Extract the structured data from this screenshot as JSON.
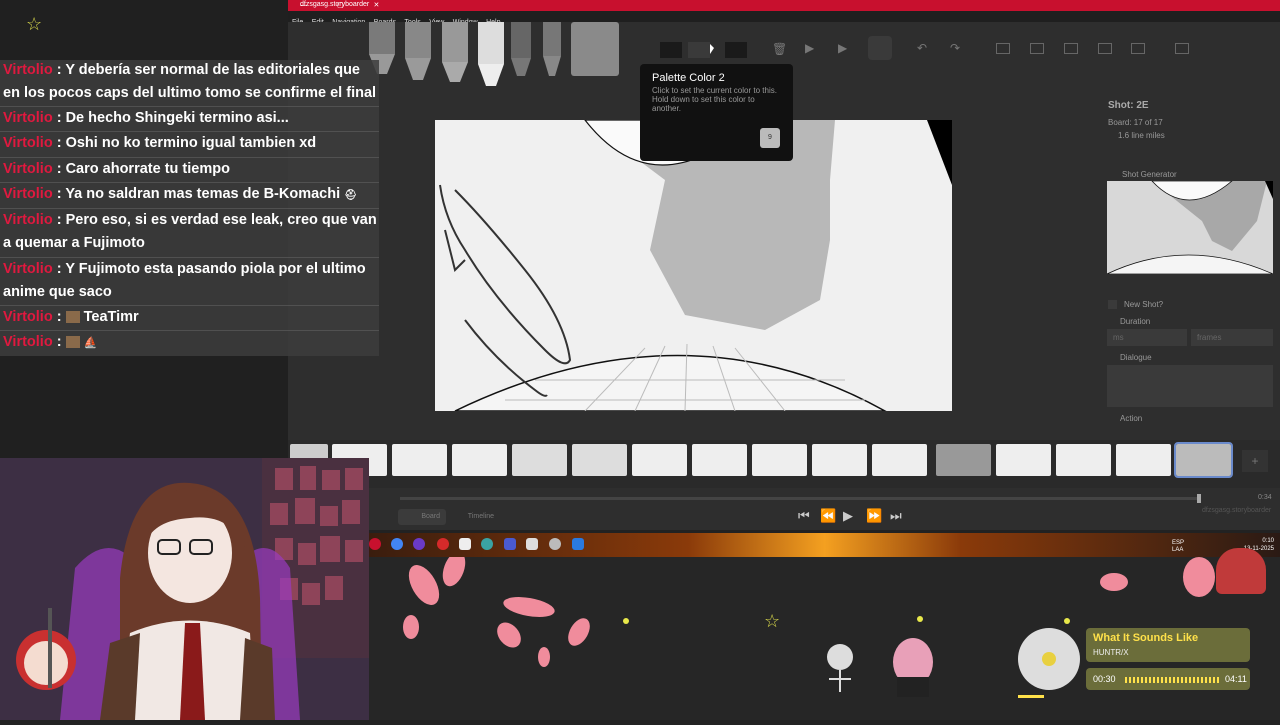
{
  "window": {
    "title": "dfzsgasg.storyboarder",
    "controls": "— ▢ ✕",
    "menu": [
      "File",
      "Edit",
      "Navigation",
      "Boards",
      "Tools",
      "View",
      "Window",
      "Help"
    ]
  },
  "chat": {
    "messages": [
      {
        "user": "Virtolio",
        "text": "Y debería ser normal de las editoriales que en los pocos caps del ultimo tomo se confirme el final"
      },
      {
        "user": "Virtolio",
        "text": "De hecho Shingeki termino asi..."
      },
      {
        "user": "Virtolio",
        "text": "Oshi no ko termino igual tambien xd"
      },
      {
        "user": "Virtolio",
        "text": "Caro ahorrate tu tiempo"
      },
      {
        "user": "Virtolio",
        "text": "Ya no saldran mas temas de B-Komachi"
      },
      {
        "user": "Virtolio",
        "text": "Pero eso, si es verdad ese leak, creo que van a quemar a Fujimoto"
      },
      {
        "user": "Virtolio",
        "text": "Y Fujimoto esta pasando piola por el ultimo anime que saco"
      },
      {
        "user": "Virtolio",
        "text": "TeaTimr"
      },
      {
        "user": "Virtolio",
        "text": ""
      }
    ]
  },
  "tooltip": {
    "title": "Palette Color 2",
    "body": "Click to set the current color to this. Hold down to set this color to another.",
    "key": "9"
  },
  "shot_panel": {
    "title": "Shot: 2E",
    "board": "Board: 17 of 17",
    "lines": "1.6 line miles",
    "generator": "Shot Generator",
    "new_shot": "New Shot?",
    "duration": "Duration",
    "duration_ms_placeholder": "ms",
    "duration_frames_placeholder": "frames",
    "dialogue": "Dialogue",
    "action": "Action"
  },
  "timeline": {
    "time": "0:34",
    "filename": "dfzsgasg.storyboarder",
    "board_tab": "Board",
    "timeline_tab": "Timeline"
  },
  "taskbar": {
    "lang": "ESP",
    "lang2": "LAA",
    "time": "0:10",
    "date": "13-11-2025"
  },
  "music": {
    "title": "What It Sounds Like",
    "artist": "HUNTR/X",
    "elapsed": "00:30",
    "total": "04:11"
  },
  "colors": {
    "accent_red": "#c8102e",
    "chat_user": "#e0193f",
    "music_title": "#ffe14a"
  }
}
